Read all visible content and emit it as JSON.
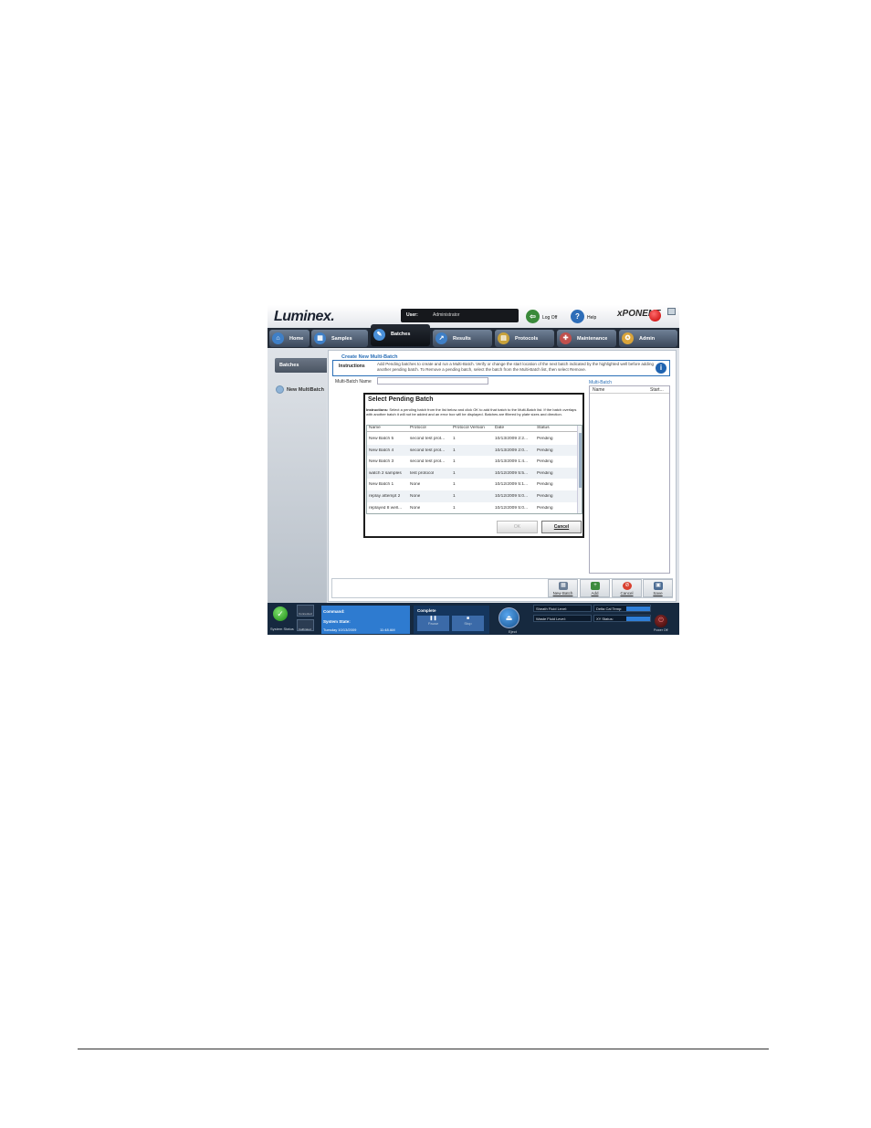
{
  "header": {
    "logo": "Luminex.",
    "user_label": "User:",
    "user_value": "Administrator",
    "logoff_label": "Log Off",
    "help_label": "Help",
    "brand": "xPONENT"
  },
  "nav": {
    "tabs": [
      {
        "label": "Home"
      },
      {
        "label": "Samples"
      },
      {
        "label": "Batches"
      },
      {
        "label": "Results"
      },
      {
        "label": "Protocols"
      },
      {
        "label": "Maintenance"
      },
      {
        "label": "Admin"
      }
    ]
  },
  "sidebar": {
    "primary": "Batches",
    "item": "New MultiBatch"
  },
  "main": {
    "title": "Create New Multi-Batch",
    "instructions_label": "Instructions",
    "instructions_text": "Add Pending batches to create and run a Multi-Batch. Verify or change the start location of the next batch indicated by the highlighted well before adding another pending batch. To Remove a pending batch, select the batch from the Multi-Batch list, then select Remove.",
    "name_label": "Multi-Batch Name",
    "name_value": "",
    "multibatch_label": "Multi-Batch",
    "multibatch_columns": [
      "Name",
      "Start..."
    ]
  },
  "dialog": {
    "title": "Select Pending Batch",
    "instructions_label": "Instructions:",
    "instructions_text": "Select a pending batch from the list below and click OK to add that batch to the Multi-Batch list. If the batch overlaps with another batch it will not be added and an error box will be displayed. Batches are filtered by plate sizes and direction.",
    "columns": [
      "Name",
      "Protocol",
      "Protocol Version",
      "Date",
      "Status"
    ],
    "rows": [
      [
        "New Batch 5",
        "second test prot...",
        "1",
        "10/13/2009 2:2...",
        "Pending"
      ],
      [
        "New Batch 4",
        "second test prot...",
        "1",
        "10/13/2009 2:0...",
        "Pending"
      ],
      [
        "New Batch 3",
        "second test prot...",
        "1",
        "10/13/2009 1:4...",
        "Pending"
      ],
      [
        "watch 2 samples",
        "test protocol",
        "1",
        "10/12/2009 5:5...",
        "Pending"
      ],
      [
        "New Batch 1",
        "None",
        "1",
        "10/12/2009 5:1...",
        "Pending"
      ],
      [
        "replay attempt 2",
        "None",
        "1",
        "10/12/2009 5:0...",
        "Pending"
      ],
      [
        "replayed 8 well...",
        "None",
        "1",
        "10/12/2009 5:0...",
        "Pending"
      ]
    ],
    "ok_label": "OK",
    "cancel_label": "Cancel"
  },
  "actions": {
    "new_batch": "New Batch",
    "add": "Add",
    "cancel": "Cancel",
    "save": "Save"
  },
  "status": {
    "system_status": "System Status",
    "connected": "Connected",
    "calibrated": "Calibrated",
    "command_label": "Command:",
    "system_state_label": "System State:",
    "date": "Tuesday 10/13/2009",
    "time": "11:48 AM",
    "progress_label": "Complete",
    "pause_label": "Pause",
    "stop_label": "Stop",
    "eject_label": "Eject",
    "sheath_label": "Sheath Fluid Level:",
    "waste_label": "Waste Fluid Level:",
    "delta_label": "Delta Cal Temp:",
    "xy_label": "XY Status:",
    "power_label": "Power Off"
  },
  "colors": {
    "accent": "#2a6fb7",
    "nav_bg": "#222a36",
    "status_bg": "#16293f"
  }
}
